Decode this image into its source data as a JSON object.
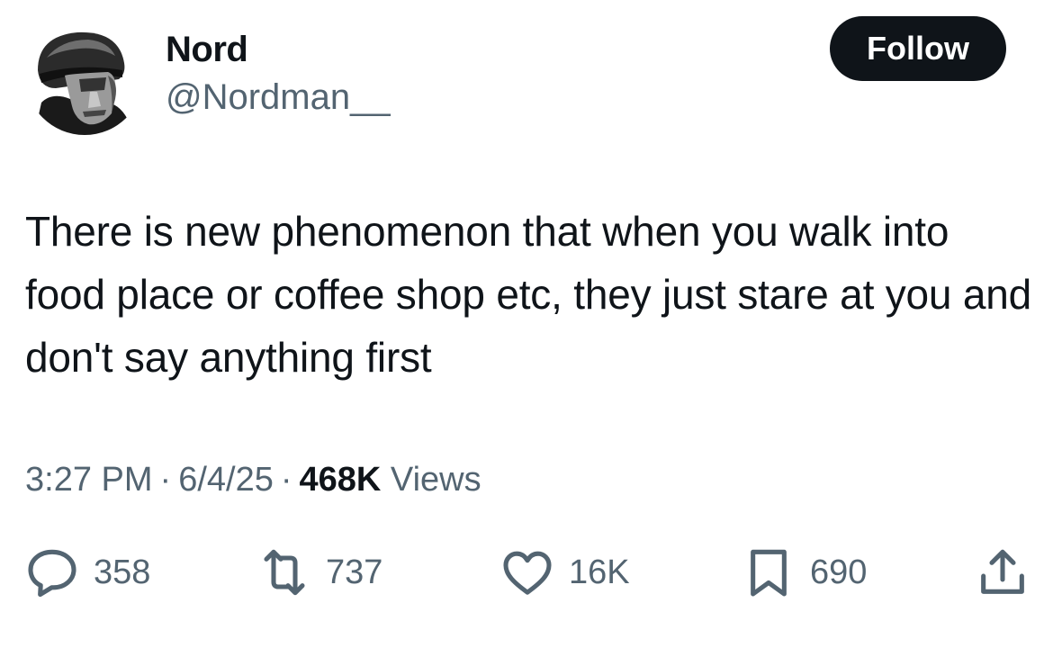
{
  "author": {
    "display_name": "Nord",
    "handle": "@Nordman__",
    "avatar": "helmeted-face-avatar"
  },
  "follow_button": {
    "label": "Follow"
  },
  "tweet": {
    "text": "There is new phenomenon that when you walk into food place or coffee shop etc, they just stare at you and don't say anything first"
  },
  "meta": {
    "time": "3:27 PM",
    "date": "6/4/25",
    "separator": "·",
    "views_count": "468K",
    "views_label": "Views"
  },
  "actions": {
    "reply": {
      "icon": "reply-icon",
      "count": "358"
    },
    "retweet": {
      "icon": "retweet-icon",
      "count": "737"
    },
    "like": {
      "icon": "heart-icon",
      "count": "16K"
    },
    "bookmark": {
      "icon": "bookmark-icon",
      "count": "690"
    },
    "share": {
      "icon": "share-icon"
    }
  },
  "colors": {
    "text_primary": "#0f1419",
    "text_secondary": "#536471",
    "button_bg": "#0f1419",
    "button_text": "#ffffff",
    "background": "#ffffff"
  }
}
